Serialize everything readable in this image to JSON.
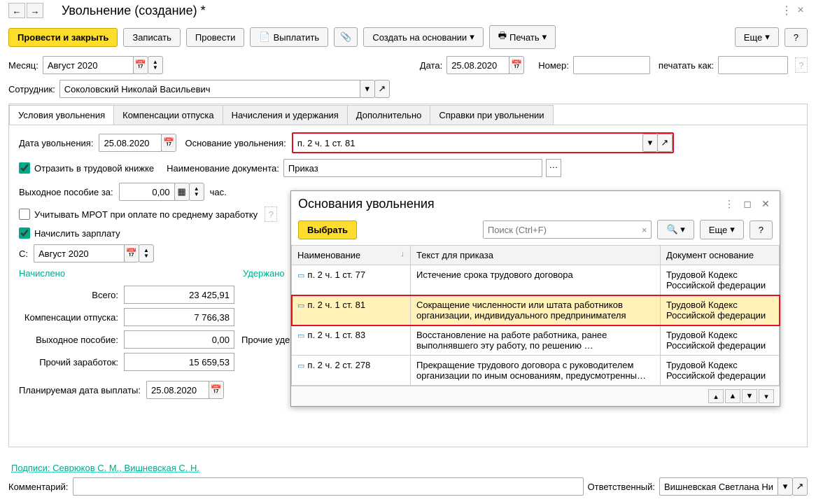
{
  "header": {
    "title": "Увольнение (создание) *"
  },
  "toolbar": {
    "submit": "Провести и закрыть",
    "save": "Записать",
    "post": "Провести",
    "pay": "Выплатить",
    "createFrom": "Создать на основании",
    "print": "Печать",
    "more": "Еще",
    "help": "?"
  },
  "fields": {
    "monthLabel": "Месяц:",
    "month": "Август 2020",
    "dateLabel": "Дата:",
    "date": "25.08.2020",
    "numberLabel": "Номер:",
    "number": "",
    "printAsLabel": "печатать как:",
    "printAs": "",
    "employeeLabel": "Сотрудник:",
    "employee": "Соколовский Николай Васильевич",
    "responsibleLabel": "Ответственный:",
    "responsible": "Вишневская Светлана Ни",
    "commentLabel": "Комментарий:",
    "comment": ""
  },
  "tabs": [
    "Условия увольнения",
    "Компенсации отпуска",
    "Начисления и удержания",
    "Дополнительно",
    "Справки при увольнении"
  ],
  "dismissal": {
    "dateLabel": "Дата увольнения:",
    "date": "25.08.2020",
    "reasonLabel": "Основание увольнения:",
    "reason": "п. 2 ч. 1 ст. 81",
    "reflectLabel": "Отразить в трудовой книжке",
    "docNameLabel": "Наименование документа:",
    "docName": "Приказ",
    "severanceForLabel": "Выходное пособие за:",
    "severanceDays": "0,00",
    "hoursLabel": "час.",
    "mrotLabel": "Учитывать МРОТ при оплате по среднему заработку",
    "accrueLabel": "Начислить зарплату",
    "fromLabel": "С:",
    "fromMonth": "Август 2020"
  },
  "totals": {
    "accrued": "Начислено",
    "withheld": "Удержано",
    "rows": [
      {
        "label": "Всего:",
        "value": "23 425,91",
        "extra": ""
      },
      {
        "label": "Компенсации отпуска:",
        "value": "7 766,38",
        "extra": ""
      },
      {
        "label": "Выходное пособие:",
        "value": "0,00",
        "extra": "Прочие уде"
      },
      {
        "label": "Прочий заработок:",
        "value": "15 659,53",
        "extra": ""
      }
    ],
    "payDateLabel": "Планируемая дата выплаты:",
    "payDate": "25.08.2020"
  },
  "signatures": "Подписи: Севрюков С. М., Вишневская С. Н.",
  "popup": {
    "title": "Основания увольнения",
    "select": "Выбрать",
    "more": "Еще",
    "help": "?",
    "searchPlaceholder": "Поиск (Ctrl+F)",
    "cols": [
      "Наименование",
      "Текст для приказа",
      "Документ основание"
    ],
    "rows": [
      {
        "name": "п. 2 ч. 1 ст. 77",
        "text": "Истечение срока трудового договора",
        "doc": "Трудовой Кодекс Российской федерации",
        "sel": false
      },
      {
        "name": "п. 2 ч. 1 ст. 81",
        "text": "Сокращение численности или штата работников организации, индивидуального предпринимателя",
        "doc": "Трудовой Кодекс Российской федерации",
        "sel": true
      },
      {
        "name": "п. 2 ч. 1 ст. 83",
        "text": "Восстановление на работе работника, ранее выполнявшего эту работу, по решению …",
        "doc": "Трудовой Кодекс Российской федерации",
        "sel": false
      },
      {
        "name": "п. 2 ч. 2 ст. 278",
        "text": "Прекращение трудового договора с руководителем организации по иным основаниям, предусмотренны…",
        "doc": "Трудовой Кодекс Российской федерации",
        "sel": false
      }
    ]
  }
}
